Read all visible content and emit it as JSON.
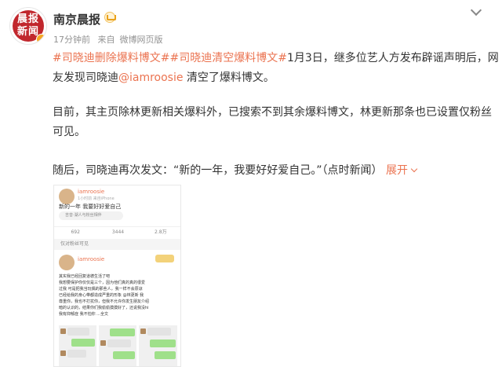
{
  "post": {
    "author": "南京晨报",
    "time": "17分钟前",
    "source_prefix": "来自",
    "source": "微博网页版",
    "paragraph1": {
      "topic1": "#司晓迪删除爆料博文#",
      "topic2": "#司晓迪清空爆料博文#",
      "text1": "1月3日，继多位艺人方发布辟谣声明后，网友发现司晓迪",
      "mention": "@iamroosie",
      "text2": " 清空了爆料博文。"
    },
    "paragraph2": "目前，其主页除林更新相关爆料外，已搜索不到其余爆料博文，林更新那条也已设置仅粉丝可见。",
    "paragraph3": "随后，司晓迪再次发文：“新的一年，我要好好爱自己。”（点时新闻）",
    "expand_label": "展开",
    "colors": {
      "accent": "#eb7350",
      "text": "#333333",
      "meta": "#939393"
    }
  },
  "embedded_image": {
    "top_post": {
      "name": "iamroosie",
      "device": "1小时前 来自iPhone",
      "text": "新的一年 我要好好爱自己",
      "source": "吉音·湖人与粉丝相伴",
      "stats": [
        "692",
        "3444",
        "2.8万"
      ]
    },
    "tip": "仅对粉丝可见",
    "second_post": {
      "name": "iamroosie",
      "text_lines": [
        "其实我已经回复道德生活了吧",
        "我想要保护你仅仅是三个，因为他们真的真的很爱",
        "过我 可是把我当玩偶的那些人，我一样不会原谅",
        "已经给我的身心带都造成严重的形象 @林更新 我",
        "尊重你，我也不打扰你，但我不允许你发生朋友介绍",
        "暗的认识的，结果你们我偷偷摸摸好了，还说我没hi",
        "我有抑郁症 我不怕你 ...全文"
      ]
    }
  }
}
